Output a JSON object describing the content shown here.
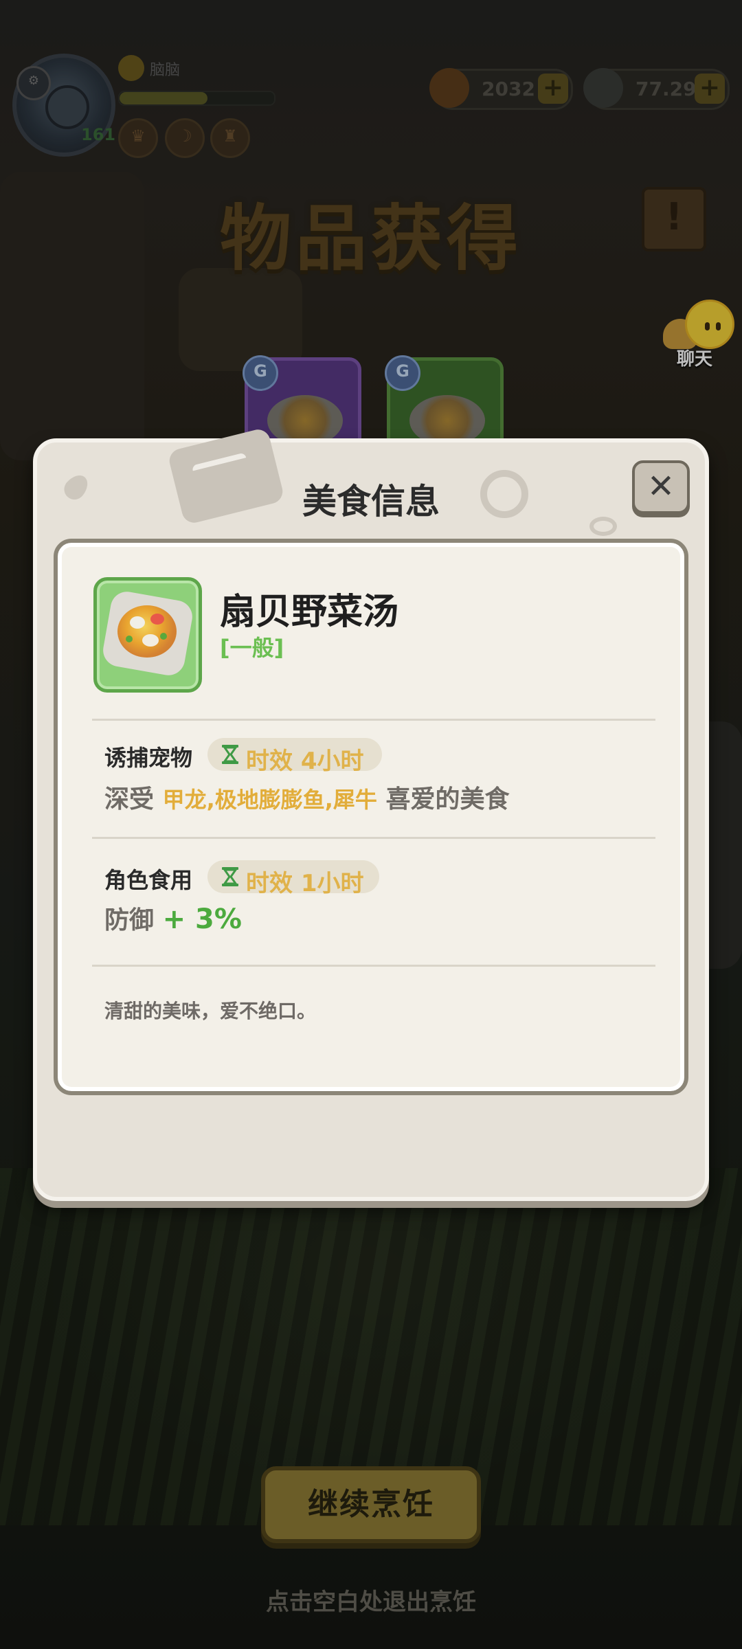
{
  "hud": {
    "player_name": "脑脑",
    "level": "161",
    "xp_progress": 0.57,
    "gold": "2032",
    "coins": "77.29M"
  },
  "banner": {
    "title": "物品获得"
  },
  "chat": {
    "label": "聊天"
  },
  "modal": {
    "title": "美食信息",
    "close_symbol": "✕",
    "food": {
      "name": "扇贝野菜汤",
      "rarity": "[一般]"
    },
    "lure": {
      "label": "诱捕宠物",
      "duration": "时效 4小时",
      "desc_prefix": "深受",
      "pets": "甲龙,极地膨膨鱼,犀牛",
      "desc_suffix": "喜爱的美食"
    },
    "eat": {
      "label": "角色食用",
      "duration": "时效 1小时",
      "stat": "防御",
      "bonus": "+ 3%"
    },
    "flavor_text": "清甜的美味，爱不绝口。"
  },
  "footer": {
    "cook_button": "继续烹饪",
    "exit_hint": "点击空白处退出烹饪"
  },
  "colors": {
    "rarity_green": "#6bbf52",
    "highlight_gold": "#e2ad3a",
    "bonus_green": "#4caa3e"
  }
}
